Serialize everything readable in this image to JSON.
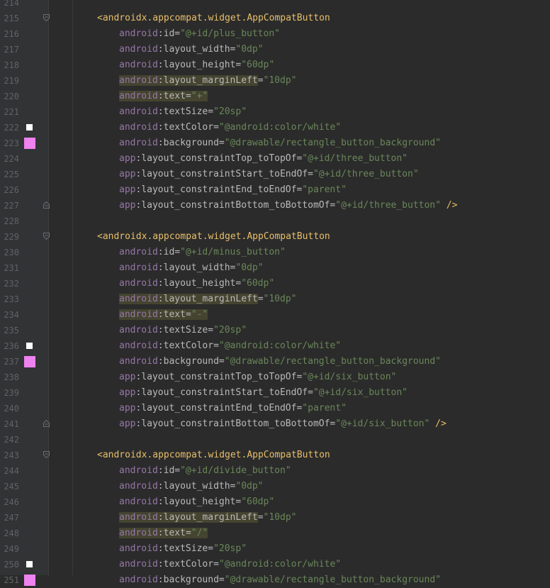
{
  "editor": {
    "lines": [
      {
        "n": "214",
        "kind": "blank"
      },
      {
        "n": "215",
        "kind": "tag",
        "text": "<androidx.appcompat.widget.AppCompatButton",
        "fold": "open"
      },
      {
        "n": "216",
        "kind": "attr",
        "ns": "android",
        "name": "id",
        "value": "\"@+id/plus_button\""
      },
      {
        "n": "217",
        "kind": "attr",
        "ns": "android",
        "name": "layout_width",
        "value": "\"0dp\""
      },
      {
        "n": "218",
        "kind": "attr",
        "ns": "android",
        "name": "layout_height",
        "value": "\"60dp\""
      },
      {
        "n": "219",
        "kind": "attr",
        "ns": "android",
        "name": "layout_marginLeft",
        "value": "\"10dp\"",
        "hl": true
      },
      {
        "n": "220",
        "kind": "attr",
        "ns": "android",
        "name": "text",
        "value": "\"+\"",
        "hl": true,
        "hlval": true
      },
      {
        "n": "221",
        "kind": "attr",
        "ns": "android",
        "name": "textSize",
        "value": "\"20sp\""
      },
      {
        "n": "222",
        "kind": "attr",
        "ns": "android",
        "name": "textColor",
        "value": "\"@android:color/white\"",
        "swatch": "white"
      },
      {
        "n": "223",
        "kind": "attr",
        "ns": "android",
        "name": "background",
        "value": "\"@drawable/rectangle_button_background\"",
        "swatch": "pink"
      },
      {
        "n": "224",
        "kind": "attr",
        "ns": "app",
        "name": "layout_constraintTop_toTopOf",
        "value": "\"@+id/three_button\""
      },
      {
        "n": "225",
        "kind": "attr",
        "ns": "app",
        "name": "layout_constraintStart_toEndOf",
        "value": "\"@+id/three_button\""
      },
      {
        "n": "226",
        "kind": "attr",
        "ns": "app",
        "name": "layout_constraintEnd_toEndOf",
        "value": "\"parent\""
      },
      {
        "n": "227",
        "kind": "attr",
        "ns": "app",
        "name": "layout_constraintBottom_toBottomOf",
        "value": "\"@+id/three_button\"",
        "close": " />",
        "fold": "end"
      },
      {
        "n": "228",
        "kind": "blank"
      },
      {
        "n": "229",
        "kind": "tag",
        "text": "<androidx.appcompat.widget.AppCompatButton",
        "fold": "open"
      },
      {
        "n": "230",
        "kind": "attr",
        "ns": "android",
        "name": "id",
        "value": "\"@+id/minus_button\""
      },
      {
        "n": "231",
        "kind": "attr",
        "ns": "android",
        "name": "layout_width",
        "value": "\"0dp\""
      },
      {
        "n": "232",
        "kind": "attr",
        "ns": "android",
        "name": "layout_height",
        "value": "\"60dp\""
      },
      {
        "n": "233",
        "kind": "attr",
        "ns": "android",
        "name": "layout_marginLeft",
        "value": "\"10dp\"",
        "hl": true
      },
      {
        "n": "234",
        "kind": "attr",
        "ns": "android",
        "name": "text",
        "value": "\"-\"",
        "hl": true,
        "hlval": true
      },
      {
        "n": "235",
        "kind": "attr",
        "ns": "android",
        "name": "textSize",
        "value": "\"20sp\""
      },
      {
        "n": "236",
        "kind": "attr",
        "ns": "android",
        "name": "textColor",
        "value": "\"@android:color/white\"",
        "swatch": "white"
      },
      {
        "n": "237",
        "kind": "attr",
        "ns": "android",
        "name": "background",
        "value": "\"@drawable/rectangle_button_background\"",
        "swatch": "pink"
      },
      {
        "n": "238",
        "kind": "attr",
        "ns": "app",
        "name": "layout_constraintTop_toTopOf",
        "value": "\"@+id/six_button\""
      },
      {
        "n": "239",
        "kind": "attr",
        "ns": "app",
        "name": "layout_constraintStart_toEndOf",
        "value": "\"@+id/six_button\""
      },
      {
        "n": "240",
        "kind": "attr",
        "ns": "app",
        "name": "layout_constraintEnd_toEndOf",
        "value": "\"parent\""
      },
      {
        "n": "241",
        "kind": "attr",
        "ns": "app",
        "name": "layout_constraintBottom_toBottomOf",
        "value": "\"@+id/six_button\"",
        "close": " />",
        "fold": "end"
      },
      {
        "n": "242",
        "kind": "blank"
      },
      {
        "n": "243",
        "kind": "tag",
        "text": "<androidx.appcompat.widget.AppCompatButton",
        "fold": "open"
      },
      {
        "n": "244",
        "kind": "attr",
        "ns": "android",
        "name": "id",
        "value": "\"@+id/divide_button\""
      },
      {
        "n": "245",
        "kind": "attr",
        "ns": "android",
        "name": "layout_width",
        "value": "\"0dp\""
      },
      {
        "n": "246",
        "kind": "attr",
        "ns": "android",
        "name": "layout_height",
        "value": "\"60dp\""
      },
      {
        "n": "247",
        "kind": "attr",
        "ns": "android",
        "name": "layout_marginLeft",
        "value": "\"10dp\"",
        "hl": true
      },
      {
        "n": "248",
        "kind": "attr",
        "ns": "android",
        "name": "text",
        "value": "\"/\"",
        "hl": true,
        "hlval": true
      },
      {
        "n": "249",
        "kind": "attr",
        "ns": "android",
        "name": "textSize",
        "value": "\"20sp\""
      },
      {
        "n": "250",
        "kind": "attr",
        "ns": "android",
        "name": "textColor",
        "value": "\"@android:color/white\"",
        "swatch": "white"
      },
      {
        "n": "251",
        "kind": "attr",
        "ns": "android",
        "name": "background",
        "value": "\"@drawable/rectangle_button_background\"",
        "swatch": "pink"
      }
    ]
  }
}
